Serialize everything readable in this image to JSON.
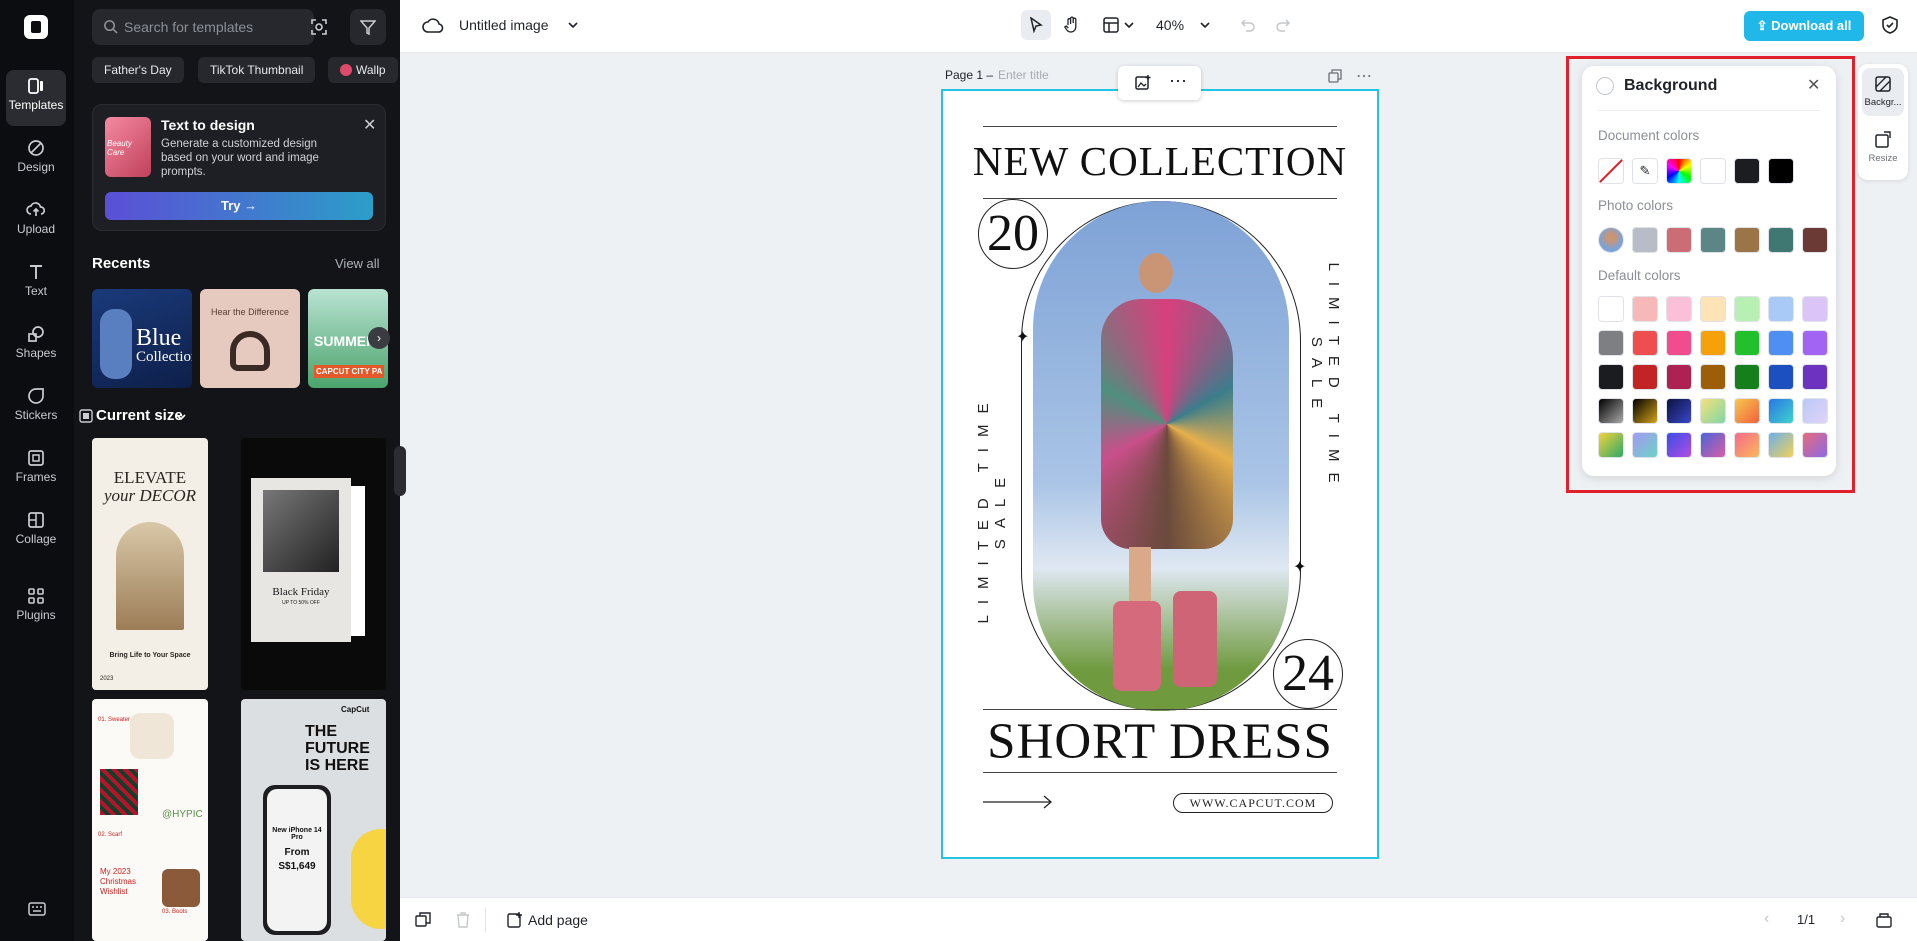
{
  "rail": {
    "items": [
      {
        "label": "Templates",
        "icon": "templates-icon"
      },
      {
        "label": "Design",
        "icon": "design-icon"
      },
      {
        "label": "Upload",
        "icon": "upload-icon"
      },
      {
        "label": "Text",
        "icon": "text-icon"
      },
      {
        "label": "Shapes",
        "icon": "shapes-icon"
      },
      {
        "label": "Stickers",
        "icon": "stickers-icon"
      },
      {
        "label": "Frames",
        "icon": "frames-icon"
      },
      {
        "label": "Collage",
        "icon": "collage-icon"
      },
      {
        "label": "Plugins",
        "icon": "plugins-icon"
      }
    ]
  },
  "panel": {
    "search_placeholder": "Search for templates",
    "chips": [
      "Father's Day",
      "TikTok Thumbnail",
      "Wallp"
    ],
    "promo": {
      "title": "Text to design",
      "desc": "Generate a customized design based on your word and image prompts.",
      "thumb_text": "Beauty Care",
      "try": "Try →"
    },
    "recents_title": "Recents",
    "view_all": "View all",
    "recents": [
      {
        "line1": "Blue",
        "line2": "Collection"
      },
      {
        "line1": "Hear the Difference"
      },
      {
        "line1": "SUMMER",
        "line2": "CAPCUT CITY PA"
      }
    ],
    "size_label": "Current size",
    "templates": {
      "t1": {
        "top": "ELEVATE",
        "mid": "your DECOR",
        "foot": "Bring Life to Your Space",
        "year": "2023"
      },
      "t2": {
        "title": "Black Friday",
        "sub": "UP TO 50% OFF"
      },
      "t3": {
        "tag": "@HYPIC",
        "list1": "01. Sweater",
        "list2": "02. Scarf",
        "list3": "03. Boots",
        "title": "My 2023 Christmas Wishlist"
      },
      "t4": {
        "head": "THE FUTURE IS HERE",
        "brand": "CapCut",
        "phone": "New iPhone 14 Pro",
        "price_from": "From",
        "price": "S$1,649"
      }
    }
  },
  "topbar": {
    "title": "Untitled image",
    "zoom": "40%",
    "download": "Download all"
  },
  "page": {
    "label": "Page 1 –",
    "title_placeholder": "Enter title"
  },
  "design": {
    "headline": "NEW COLLECTION",
    "num1": "20",
    "num2": "24",
    "side_left": "LIMITED TIME SALE",
    "side_right": "LIMITED TIME SALE",
    "title": "SHORT DRESS",
    "url": "WWW.CAPCUT.COM"
  },
  "bg_panel": {
    "title": "Background",
    "doc_colors": "Document colors",
    "photo_colors": "Photo colors",
    "default_colors": "Default colors",
    "doc_swatches": [
      "#ffffff",
      "#ffffff",
      "rainbow",
      "#ffffff",
      "#1c1d21",
      "#000000"
    ],
    "photo_swatches": [
      "photo",
      "#b7bcc6",
      "#cc6d76",
      "#5c8585",
      "#9b7448",
      "#3f7772",
      "#6b3a34"
    ],
    "default_rows": [
      [
        "#ffffff",
        "#f9b8b8",
        "#fbc0d8",
        "#fde3b5",
        "#b8efb3",
        "#a9c9f7",
        "#dac4f8"
      ],
      [
        "#7d7f83",
        "#ef4e4e",
        "#f14d8e",
        "#f5a10a",
        "#22c12c",
        "#4f8ff4",
        "#a265f3"
      ],
      [
        "#1b1c1f",
        "#c22424",
        "#ad2153",
        "#9c5e07",
        "#15801b",
        "#1c50c1",
        "#6c32c0"
      ],
      [
        "g1",
        "g2",
        "g3",
        "g4",
        "g5",
        "g6",
        "g7"
      ],
      [
        "g8",
        "g9",
        "g10",
        "g11",
        "g12",
        "g13",
        "g14"
      ]
    ]
  },
  "right_tools": [
    {
      "label": "Backgr..."
    },
    {
      "label": "Resize"
    }
  ],
  "bottom": {
    "add_page": "Add page",
    "pager": "1/1"
  }
}
